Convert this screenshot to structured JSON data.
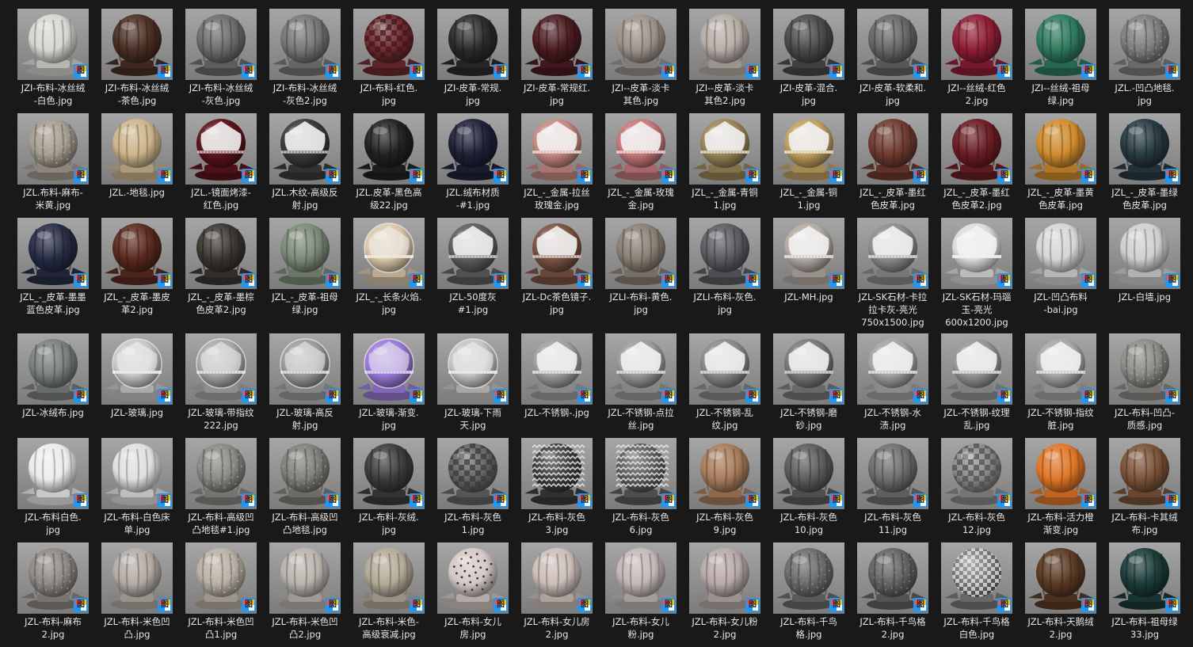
{
  "badge_glyph": "图",
  "items": [
    {
      "name": "JZI-布料-冰丝绒\n-白色.jpg",
      "color": "#d8d6d2",
      "pattern": "plain"
    },
    {
      "name": "JZI-布料-冰丝绒\n-茶色.jpg",
      "color": "#4a2f24",
      "pattern": "plain"
    },
    {
      "name": "JZI-布料-冰丝绒\n-灰色.jpg",
      "color": "#6c6c6c",
      "pattern": "plain"
    },
    {
      "name": "JZI-布料-冰丝绒\n-灰色2.jpg",
      "color": "#767676",
      "pattern": "plain"
    },
    {
      "name": "JZI-布料-红色.\njpg",
      "color": "#6e2a2e",
      "pattern": "grid"
    },
    {
      "name": "JZI-皮革-常规.\njpg",
      "color": "#2b2b2e",
      "pattern": "plain"
    },
    {
      "name": "JZI-皮革-常规红.\njpg",
      "color": "#4a1c20",
      "pattern": "plain"
    },
    {
      "name": "JZI--皮革-淡卡\n其色.jpg",
      "color": "#9c928a",
      "pattern": "plain"
    },
    {
      "name": "JZI--皮革-淡卡\n其色2.jpg",
      "color": "#b7aea6",
      "pattern": "plain"
    },
    {
      "name": "JZI-皮革-混合.\njpg",
      "color": "#4a4a4a",
      "pattern": "plain"
    },
    {
      "name": "JZI-皮革-软柔和.\njpg",
      "color": "#666666",
      "pattern": "plain"
    },
    {
      "name": "JZI--丝绒-红色\n2.jpg",
      "color": "#8d1e34",
      "pattern": "plain"
    },
    {
      "name": "JZI--丝绒-祖母\n绿.jpg",
      "color": "#2f7a5e",
      "pattern": "plain"
    },
    {
      "name": "JZL.-凹凸地毯.\njpg",
      "color": "#7c7c7a",
      "pattern": "fuzzy"
    },
    {
      "name": "JZL.布料-麻布-\n米黄.jpg",
      "color": "#a49c8f",
      "pattern": "fuzzy"
    },
    {
      "name": "JZL.-地毯.jpg",
      "color": "#cdb58b",
      "pattern": "plain"
    },
    {
      "name": "JZL.-镜面烤漆-\n红色.jpg",
      "color": "#5a141c",
      "pattern": "mirror"
    },
    {
      "name": "JZL.木纹-高级反\n射.jpg",
      "color": "#3a3a3a",
      "pattern": "mirror"
    },
    {
      "name": "JZL.皮革-黑色高\n级22.jpg",
      "color": "#222222",
      "pattern": "plain"
    },
    {
      "name": "JZL.绒布材质\n-#1.jpg",
      "color": "#1d2236",
      "pattern": "plain"
    },
    {
      "name": "JZL_-_金属-拉丝\n玫瑰金.jpg",
      "color": "#c58a82",
      "pattern": "mirror"
    },
    {
      "name": "JZL_-_金属-玫瑰\n金.jpg",
      "color": "#c4787a",
      "pattern": "mirror"
    },
    {
      "name": "JZL_-_金属-青铜\n1.jpg",
      "color": "#9a8558",
      "pattern": "mirror"
    },
    {
      "name": "JZL_-_金属-铜\n1.jpg",
      "color": "#c1a062",
      "pattern": "mirror"
    },
    {
      "name": "JZL_-_皮革-墨红\n色皮革.jpg",
      "color": "#6e3a30",
      "pattern": "plain"
    },
    {
      "name": "JZL_-_皮革-墨红\n色皮革2.jpg",
      "color": "#6a1e24",
      "pattern": "plain"
    },
    {
      "name": "JZL_-_皮革-墨黄\n色皮革.jpg",
      "color": "#d08c2e",
      "pattern": "plain"
    },
    {
      "name": "JZL_-_皮革-墨绿\n色皮革.jpg",
      "color": "#283a42",
      "pattern": "plain"
    },
    {
      "name": "JZL_-_皮革-墨墨\n蓝色皮革.jpg",
      "color": "#262c44",
      "pattern": "plain"
    },
    {
      "name": "JZL_-_皮革-墨皮\n革2.jpg",
      "color": "#5a2a20",
      "pattern": "plain"
    },
    {
      "name": "JZL_-_皮革-墨棕\n色皮革2.jpg",
      "color": "#3a3632",
      "pattern": "plain"
    },
    {
      "name": "JZL_-_皮革-祖母\n绿.jpg",
      "color": "#7c8a78",
      "pattern": "plain"
    },
    {
      "name": "JZL_-_长条火焰.\njpg",
      "color": "#d9c7a8",
      "pattern": "glass"
    },
    {
      "name": "JZL-50度灰\n#1.jpg",
      "color": "#5e5e5e",
      "pattern": "mirror"
    },
    {
      "name": "JZL-Dc茶色镜子.\njpg",
      "color": "#7a5244",
      "pattern": "mirror"
    },
    {
      "name": "JZLI-布料-黄色.\njpg",
      "color": "#8a8074",
      "pattern": "plain"
    },
    {
      "name": "JZLI-布料-灰色.\njpg",
      "color": "#5a5c60",
      "pattern": "plain"
    },
    {
      "name": "JZL-MH.jpg",
      "color": "#b4aca4",
      "pattern": "mirror"
    },
    {
      "name": "JZL-SK石材-卡拉\n拉卡灰-亮光\n750x1500.jpg",
      "color": "#8c8c8c",
      "pattern": "mirror"
    },
    {
      "name": "JZL-SK石材-玛瑙\n玉-亮光\n600x1200.jpg",
      "color": "#dcdcdc",
      "pattern": "mirror"
    },
    {
      "name": "JZL-凹凸布料\n-bai.jpg",
      "color": "#d6d6d6",
      "pattern": "plain"
    },
    {
      "name": "JZL-白墙.jpg",
      "color": "#d0d0d0",
      "pattern": "plain"
    },
    {
      "name": "JZL-冰绒布.jpg",
      "color": "#7a807c",
      "pattern": "plain"
    },
    {
      "name": "JZL-玻璃.jpg",
      "color": "#c8c8c8",
      "pattern": "glass"
    },
    {
      "name": "JZL-玻璃-带指纹\n222.jpg",
      "color": "#a8a8a8",
      "pattern": "glass"
    },
    {
      "name": "JZL-玻璃-高反\n射.jpg",
      "color": "#9c9c9c",
      "pattern": "glass"
    },
    {
      "name": "JZL-玻璃-渐变.\njpg",
      "color": "#9a7ad8",
      "pattern": "glass"
    },
    {
      "name": "JZL-玻璃-下雨\n天.jpg",
      "color": "#c4c4c4",
      "pattern": "glass"
    },
    {
      "name": "JZL-不锈钢-.jpg",
      "color": "#a0a0a0",
      "pattern": "mirror"
    },
    {
      "name": "JZL-不锈钢-点拉\n丝.jpg",
      "color": "#9c9c9c",
      "pattern": "mirror"
    },
    {
      "name": "JZL-不锈钢-乱\n纹.jpg",
      "color": "#8a8a8a",
      "pattern": "mirror"
    },
    {
      "name": "JZL-不锈钢-磨\n砂.jpg",
      "color": "#7a7a7a",
      "pattern": "mirror"
    },
    {
      "name": "JZL-不锈钢-水\n渍.jpg",
      "color": "#a4a4a4",
      "pattern": "mirror"
    },
    {
      "name": "JZL-不锈钢-纹理\n乱.jpg",
      "color": "#969696",
      "pattern": "mirror"
    },
    {
      "name": "JZL-不锈钢-指纹\n脏.jpg",
      "color": "#a8a8a8",
      "pattern": "mirror"
    },
    {
      "name": "JZL-布料-凹凸-\n质感.jpg",
      "color": "#8c8a86",
      "pattern": "fuzzy"
    },
    {
      "name": "JZL-布料白色.\njpg",
      "color": "#ececec",
      "pattern": "plain"
    },
    {
      "name": "JZL-布料-白色床\n单.jpg",
      "color": "#e0e0e0",
      "pattern": "plain"
    },
    {
      "name": "JZL-布料-高级凹\n凸地毯#1.jpg",
      "color": "#8a8884",
      "pattern": "fuzzy"
    },
    {
      "name": "JZL-布料-高级凹\n凸地毯.jpg",
      "color": "#807e7a",
      "pattern": "fuzzy"
    },
    {
      "name": "JZL-布料-灰绒.\njpg",
      "color": "#3c3c3c",
      "pattern": "plain"
    },
    {
      "name": "JZL-布料-灰色\n1.jpg",
      "color": "#646464",
      "pattern": "grid"
    },
    {
      "name": "JZL-布料-灰色\n3.jpg",
      "color": "#3a3a3a",
      "pattern": "zigzag"
    },
    {
      "name": "JZL-布料-灰色\n6.jpg",
      "color": "#5a5a5a",
      "pattern": "zigzag"
    },
    {
      "name": "JZL-布料-灰色\n9.jpg",
      "color": "#a87c5c",
      "pattern": "plain"
    },
    {
      "name": "JZL-布料-灰色\n10.jpg",
      "color": "#5c5c5c",
      "pattern": "plain"
    },
    {
      "name": "JZL-布料-灰色\n11.jpg",
      "color": "#6e6e6e",
      "pattern": "plain"
    },
    {
      "name": "JZL-布料-灰色\n12.jpg",
      "color": "#8a8a8a",
      "pattern": "grid"
    },
    {
      "name": "JZL-布料-活力橙\n渐变.jpg",
      "color": "#e07628",
      "pattern": "plain"
    },
    {
      "name": "JZL-布料-卡其绒\n布.jpg",
      "color": "#7a5238",
      "pattern": "plain"
    },
    {
      "name": "JZL-布料-麻布\n2.jpg",
      "color": "#8e8882",
      "pattern": "fuzzy"
    },
    {
      "name": "JZL-布料-米色凹\n凸.jpg",
      "color": "#b4aca4",
      "pattern": "plain"
    },
    {
      "name": "JZL-布料-米色凹\n凸1.jpg",
      "color": "#b8b0a4",
      "pattern": "fuzzy"
    },
    {
      "name": "JZL-布料-米色凹\n凸2.jpg",
      "color": "#bab4ac",
      "pattern": "plain"
    },
    {
      "name": "JZL-布料-米色-\n高级衰减.jpg",
      "color": "#b4aa98",
      "pattern": "plain"
    },
    {
      "name": "JZL-布料-女儿\n房.jpg",
      "color": "#d4c8c4",
      "pattern": "dots"
    },
    {
      "name": "JZL-布料-女儿房\n2.jpg",
      "color": "#ccbeb8",
      "pattern": "plain"
    },
    {
      "name": "JZL-布料-女儿\n粉.jpg",
      "color": "#c4b8b8",
      "pattern": "plain"
    },
    {
      "name": "JZL-布料-女儿粉\n2.jpg",
      "color": "#b8aaa8",
      "pattern": "plain"
    },
    {
      "name": "JZL-布料-千鸟\n格.jpg",
      "color": "#6a6a6a",
      "pattern": "fuzzy"
    },
    {
      "name": "JZL-布料-千鸟格\n2.jpg",
      "color": "#626262",
      "pattern": "fuzzy"
    },
    {
      "name": "JZL-布料-千鸟格\n白色.jpg",
      "color": "#7a7a7a",
      "pattern": "checker"
    },
    {
      "name": "JZL-布料-天鹅绒\n2.jpg",
      "color": "#5a3a24",
      "pattern": "plain"
    },
    {
      "name": "JZL-布料-祖母绿\n33.jpg",
      "color": "#1c3c38",
      "pattern": "plain"
    }
  ]
}
